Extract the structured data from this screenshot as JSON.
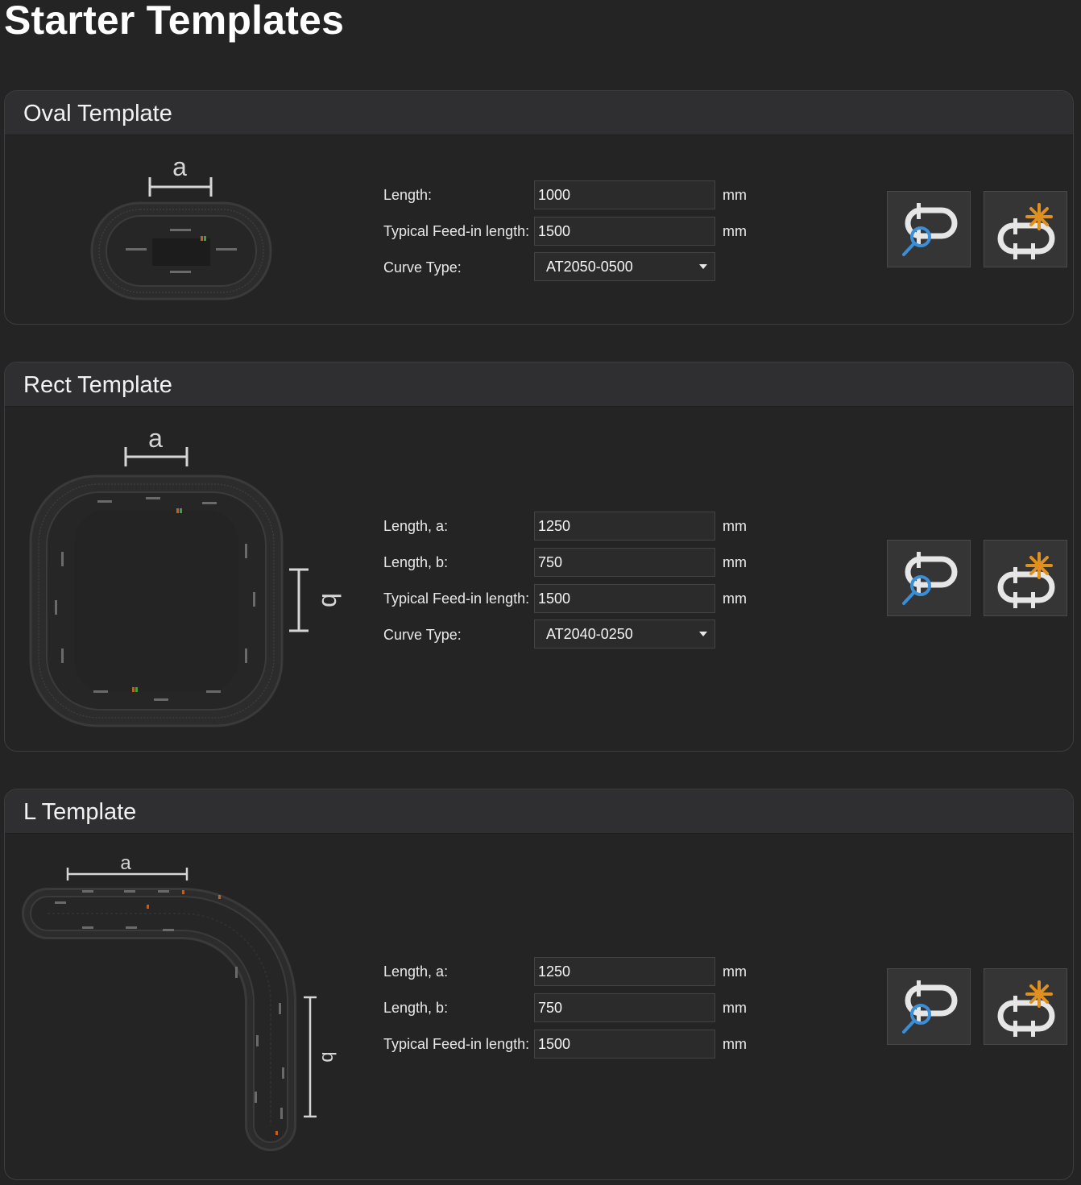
{
  "page": {
    "title": "Starter Templates"
  },
  "templates": [
    {
      "id": "oval",
      "title": "Oval Template",
      "diagram_labels": [
        "a"
      ],
      "fields": [
        {
          "label": "Length:",
          "value": "1000",
          "unit": "mm"
        },
        {
          "label": "Typical Feed-in length:",
          "value": "1500",
          "unit": "mm"
        }
      ],
      "curve": {
        "label": "Curve Type:",
        "selected": "AT2050-0500"
      },
      "buttons": {
        "preview_icon": "track-preview-icon",
        "create_icon": "track-create-icon"
      }
    },
    {
      "id": "rect",
      "title": "Rect Template",
      "diagram_labels": [
        "a",
        "b"
      ],
      "fields": [
        {
          "label": "Length, a:",
          "value": "1250",
          "unit": "mm"
        },
        {
          "label": "Length, b:",
          "value": "750",
          "unit": "mm"
        },
        {
          "label": "Typical Feed-in length:",
          "value": "1500",
          "unit": "mm"
        }
      ],
      "curve": {
        "label": "Curve Type:",
        "selected": "AT2040-0250"
      },
      "buttons": {
        "preview_icon": "track-preview-icon",
        "create_icon": "track-create-icon"
      }
    },
    {
      "id": "l",
      "title": "L Template",
      "diagram_labels": [
        "a",
        "b"
      ],
      "fields": [
        {
          "label": "Length, a:",
          "value": "1250",
          "unit": "mm"
        },
        {
          "label": "Length, b:",
          "value": "750",
          "unit": "mm"
        },
        {
          "label": "Typical Feed-in length:",
          "value": "1500",
          "unit": "mm"
        }
      ],
      "buttons": {
        "preview_icon": "track-preview-icon",
        "create_icon": "track-create-icon"
      }
    }
  ],
  "colors": {
    "background": "#242424",
    "header": "#2f2f32",
    "preview_accent": "#3a8fd8",
    "create_accent": "#e0901e"
  }
}
